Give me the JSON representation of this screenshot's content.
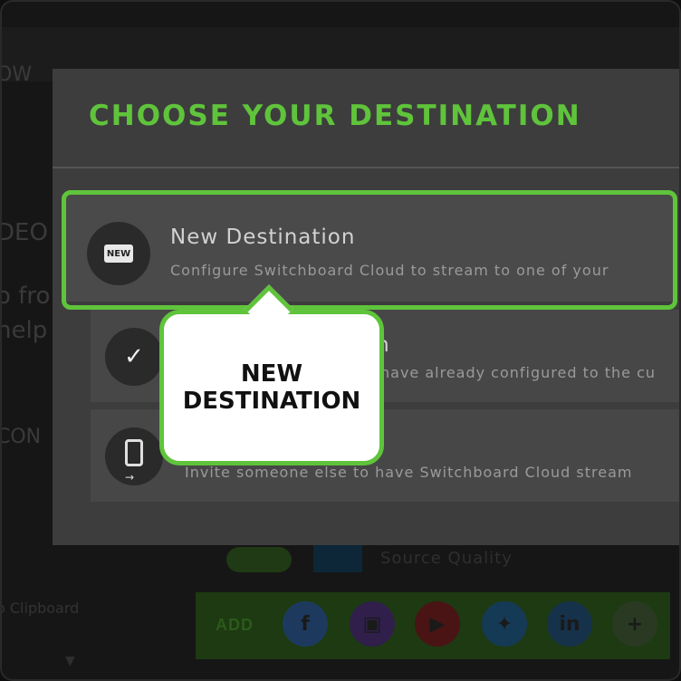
{
  "background": {
    "left_texts": [
      "OW",
      "DEO",
      "o fro",
      "help",
      "CON"
    ],
    "clipboard_label": "o Clipboard",
    "quality_label": "Source Quality",
    "add_label": "ADD",
    "social_icons": [
      {
        "name": "facebook",
        "glyph": "f",
        "color": "#1d3a5e"
      },
      {
        "name": "twitch",
        "glyph": "▣",
        "color": "#2f1f4a"
      },
      {
        "name": "youtube",
        "glyph": "▶",
        "color": "#4a1414"
      },
      {
        "name": "twitter",
        "glyph": "✦",
        "color": "#153a55"
      },
      {
        "name": "linkedin",
        "glyph": "in",
        "color": "#16324a"
      },
      {
        "name": "add",
        "glyph": "+",
        "color": "#2a3a22"
      }
    ]
  },
  "modal": {
    "title": "CHOOSE YOUR DESTINATION",
    "accent_color": "#5fc43b",
    "options": [
      {
        "icon": "new-badge-icon",
        "badge": "NEW",
        "title": "New Destination",
        "description": "Configure Switchboard Cloud to stream to one of your"
      },
      {
        "icon": "checkmark-icon",
        "title_fragment": "on",
        "description_fragment": "have already configured to the cu"
      },
      {
        "icon": "phone-icon",
        "description": "Invite someone else to have Switchboard Cloud stream"
      }
    ]
  },
  "callout": {
    "text": "NEW DESTINATION"
  }
}
